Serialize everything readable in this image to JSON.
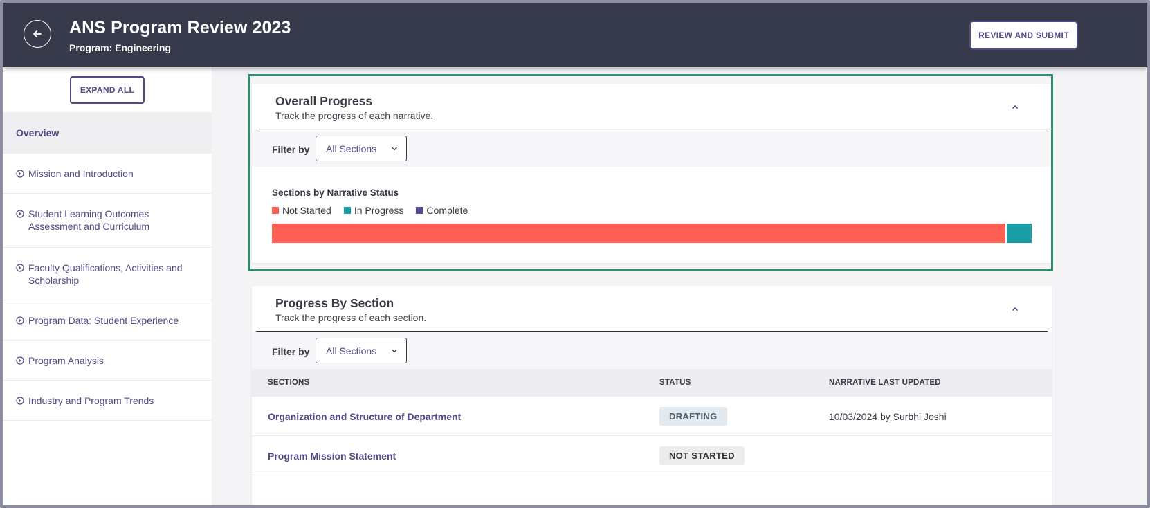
{
  "header": {
    "title": "ANS Program Review 2023",
    "subtitle": "Program: Engineering",
    "review_button": "REVIEW AND SUBMIT"
  },
  "sidebar": {
    "expand_button": "EXPAND ALL",
    "items": [
      {
        "label": "Overview",
        "active": true
      },
      {
        "label": "Mission and Introduction"
      },
      {
        "label": "Student Learning Outcomes Assessment and Curriculum"
      },
      {
        "label": "Faculty Qualifications, Activities and Scholarship"
      },
      {
        "label": "Program Data: Student Experience"
      },
      {
        "label": "Program Analysis"
      },
      {
        "label": "Industry and Program Trends"
      }
    ]
  },
  "overall": {
    "title": "Overall Progress",
    "subtitle": "Track the progress of each narrative.",
    "filter_label": "Filter by",
    "filter_value": "All Sections",
    "chart_title": "Sections by Narrative Status",
    "legend": [
      {
        "label": "Not Started",
        "color": "#ff5f52"
      },
      {
        "label": "In Progress",
        "color": "#1a9ea5"
      },
      {
        "label": "Complete",
        "color": "#4e4b99"
      }
    ]
  },
  "chart_data": {
    "type": "bar",
    "title": "Sections by Narrative Status",
    "stacked": true,
    "orientation": "horizontal",
    "series": [
      {
        "name": "Not Started",
        "share": 0.967
      },
      {
        "name": "In Progress",
        "share": 0.033
      },
      {
        "name": "Complete",
        "share": 0
      }
    ]
  },
  "by_section": {
    "title": "Progress By Section",
    "subtitle": "Track the progress of each section.",
    "filter_label": "Filter by",
    "filter_value": "All Sections",
    "columns": [
      "SECTIONS",
      "STATUS",
      "NARRATIVE LAST UPDATED"
    ],
    "rows": [
      {
        "section": "Organization and Structure of Department",
        "status": "DRAFTING",
        "updated": "10/03/2024 by Surbhi Joshi"
      },
      {
        "section": "Program Mission Statement",
        "status": "NOT STARTED",
        "updated": ""
      }
    ]
  },
  "colors": {
    "header_bg": "#363a4b",
    "accent": "#4e4b86",
    "highlight": "#2f8f6d"
  }
}
